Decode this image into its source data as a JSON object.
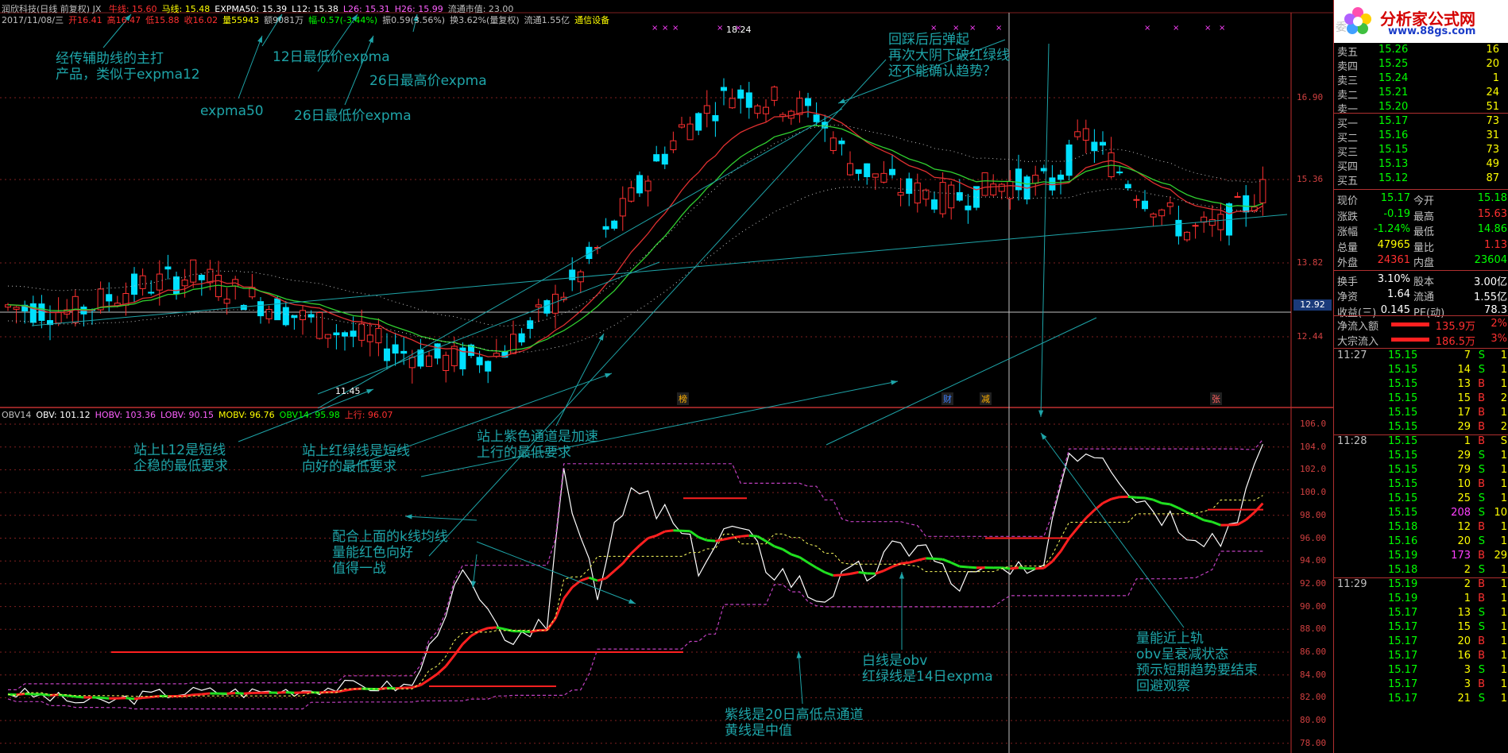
{
  "header": {
    "stock": "润欣科技(日线 前复权) JX",
    "ma_labels": [
      {
        "label": "牛线: 15.60",
        "color": "#ff3030"
      },
      {
        "label": "马线: 15.48",
        "color": "#ffff00"
      },
      {
        "label": "EXPMA50: 15.39",
        "color": "#ffffff"
      },
      {
        "label": "L12: 15.38",
        "color": "#ffffff"
      },
      {
        "label": "L26: 15.31",
        "color": "#ff60ff"
      },
      {
        "label": "H26: 15.99",
        "color": "#ff60ff"
      },
      {
        "label": "流通市值: 23.00",
        "color": "#c0c0c0"
      }
    ],
    "quote_line": [
      {
        "label": "2017/11/08/三",
        "color": "#c0c0c0"
      },
      {
        "label": "开16.41",
        "color": "#ff3030"
      },
      {
        "label": "高16.47",
        "color": "#ff3030"
      },
      {
        "label": "低15.88",
        "color": "#ff3030"
      },
      {
        "label": "收16.02",
        "color": "#ff3030"
      },
      {
        "label": "量55943",
        "color": "#ffff00"
      },
      {
        "label": "额9081万",
        "color": "#c0c0c0"
      },
      {
        "label": "幅-0.57(-3.44%)",
        "color": "#00ff00"
      },
      {
        "label": "振0.59(3.56%)",
        "color": "#c0c0c0"
      },
      {
        "label": "换3.62%(量复权)",
        "color": "#c0c0c0"
      },
      {
        "label": "流通1.55亿",
        "color": "#c0c0c0"
      },
      {
        "label": "通信设备",
        "color": "#ffff00"
      }
    ]
  },
  "obv_header": [
    {
      "label": "OBV14",
      "color": "#c0c0c0"
    },
    {
      "label": "OBV: 101.12",
      "color": "#ffffff"
    },
    {
      "label": "HOBV: 103.36",
      "color": "#ff60ff"
    },
    {
      "label": "LOBV: 90.15",
      "color": "#ff60ff"
    },
    {
      "label": "MOBV: 96.76",
      "color": "#ffff00"
    },
    {
      "label": "OBV14: 95.98",
      "color": "#00ff00"
    },
    {
      "label": "上行: 96.07",
      "color": "#ff3030"
    }
  ],
  "price_axis": [
    "16.90",
    "15.36",
    "13.82",
    "12.44"
  ],
  "price_tag": "12.92",
  "high_label": "18.24",
  "low_label": "11.45",
  "obv_axis": [
    "106.0",
    "104.0",
    "102.0",
    "100.0",
    "98.00",
    "96.00",
    "94.00",
    "92.00",
    "90.00",
    "88.00",
    "86.00",
    "84.00",
    "82.00",
    "80.00",
    "78.00"
  ],
  "event_marks": [
    {
      "label": "榜",
      "color": "#ffb000"
    },
    {
      "label": "财",
      "color": "#4080ff"
    },
    {
      "label": "减",
      "color": "#ffb000"
    },
    {
      "label": "张",
      "color": "#ff6060"
    }
  ],
  "annotations": [
    {
      "text": "经传辅助线的主打\n产品，类似于expma12"
    },
    {
      "text": "12日最低价expma"
    },
    {
      "text": "26日最高价expma"
    },
    {
      "text": "expma50"
    },
    {
      "text": "26日最低价expma"
    },
    {
      "text": "回踩后后弹起\n再次大阴下破红绿线\n还不能确认趋势？"
    },
    {
      "text": "站上L12是短线\n企稳的最低要求"
    },
    {
      "text": "站上红绿线是短线\n向好的最低要求"
    },
    {
      "text": "站上紫色通道是加速\n上行的最低要求"
    },
    {
      "text": "配合上面的k线均线\n量能红色向好\n值得一战"
    },
    {
      "text": "白线是obv\n红绿线是14日expma"
    },
    {
      "text": "紫线是20日高低点通道\n黄线是中值"
    },
    {
      "text": "量能近上轨\nobv呈衰减状态\n预示短期趋势要结束\n回避观察"
    }
  ],
  "logo": {
    "title": "分析家公式网",
    "url": "www.88gs.com",
    "corner": "委"
  },
  "order_book": {
    "asks": [
      {
        "label": "卖五",
        "price": "15.26",
        "vol": "16"
      },
      {
        "label": "卖四",
        "price": "15.25",
        "vol": "20"
      },
      {
        "label": "卖三",
        "price": "15.24",
        "vol": "1"
      },
      {
        "label": "卖二",
        "price": "15.21",
        "vol": "24"
      },
      {
        "label": "卖一",
        "price": "15.20",
        "vol": "51"
      }
    ],
    "bids": [
      {
        "label": "买一",
        "price": "15.17",
        "vol": "73"
      },
      {
        "label": "买二",
        "price": "15.16",
        "vol": "31"
      },
      {
        "label": "买三",
        "price": "15.15",
        "vol": "73"
      },
      {
        "label": "买四",
        "price": "15.13",
        "vol": "49"
      },
      {
        "label": "买五",
        "price": "15.12",
        "vol": "87"
      }
    ]
  },
  "stats": [
    {
      "l1": "现价",
      "v1": "15.17",
      "c1": "#00ff00",
      "l2": "今开",
      "v2": "15.18",
      "c2": "#00ff00"
    },
    {
      "l1": "涨跌",
      "v1": "-0.19",
      "c1": "#00ff00",
      "l2": "最高",
      "v2": "15.63",
      "c2": "#ff3030"
    },
    {
      "l1": "涨幅",
      "v1": "-1.24%",
      "c1": "#00ff00",
      "l2": "最低",
      "v2": "14.86",
      "c2": "#00ff00"
    },
    {
      "l1": "总量",
      "v1": "47965",
      "c1": "#ffff00",
      "l2": "量比",
      "v2": "1.13",
      "c2": "#ff3030"
    },
    {
      "l1": "外盘",
      "v1": "24361",
      "c1": "#ff3030",
      "l2": "内盘",
      "v2": "23604",
      "c2": "#00ff00"
    },
    {
      "l1": "换手",
      "v1": "3.10%",
      "c1": "#ffffff",
      "l2": "股本",
      "v2": "3.00亿",
      "c2": "#ffffff"
    },
    {
      "l1": "净资",
      "v1": "1.64",
      "c1": "#ffffff",
      "l2": "流通",
      "v2": "1.55亿",
      "c2": "#ffffff"
    },
    {
      "l1": "收益(三)",
      "v1": "0.145",
      "c1": "#ffffff",
      "l2": "PE(动)",
      "v2": "78.3",
      "c2": "#ffffff"
    }
  ],
  "flows": [
    {
      "label": "净流入额",
      "value": "135.9万",
      "pct": "2%"
    },
    {
      "label": "大宗流入",
      "value": "186.5万",
      "pct": "3%"
    }
  ],
  "ticks": [
    {
      "time": "11:27",
      "price": "15.15",
      "vol": "7",
      "side": "S"
    },
    {
      "time": "",
      "price": "15.15",
      "vol": "14",
      "side": "S"
    },
    {
      "time": "",
      "price": "15.15",
      "vol": "13",
      "side": "B"
    },
    {
      "time": "",
      "price": "15.15",
      "vol": "15",
      "side": "B"
    },
    {
      "time": "",
      "price": "15.15",
      "vol": "17",
      "side": "B"
    },
    {
      "time": "",
      "price": "15.15",
      "vol": "29",
      "side": "B"
    },
    {
      "time": "11:28",
      "price": "15.15",
      "vol": "1",
      "side": "B"
    },
    {
      "time": "",
      "price": "15.15",
      "vol": "29",
      "side": "S"
    },
    {
      "time": "",
      "price": "15.15",
      "vol": "79",
      "side": "S"
    },
    {
      "time": "",
      "price": "15.15",
      "vol": "10",
      "side": "B"
    },
    {
      "time": "",
      "price": "15.15",
      "vol": "25",
      "side": "S"
    },
    {
      "time": "",
      "price": "15.15",
      "vol": "208",
      "side": "S"
    },
    {
      "time": "",
      "price": "15.18",
      "vol": "12",
      "side": "B"
    },
    {
      "time": "",
      "price": "15.16",
      "vol": "20",
      "side": "S"
    },
    {
      "time": "",
      "price": "15.19",
      "vol": "173",
      "side": "B"
    },
    {
      "time": "",
      "price": "15.18",
      "vol": "2",
      "side": "S"
    },
    {
      "time": "11:29",
      "price": "15.19",
      "vol": "2",
      "side": "B"
    },
    {
      "time": "",
      "price": "15.19",
      "vol": "1",
      "side": "B"
    },
    {
      "time": "",
      "price": "15.17",
      "vol": "13",
      "side": "S"
    },
    {
      "time": "",
      "price": "15.17",
      "vol": "15",
      "side": "S"
    },
    {
      "time": "",
      "price": "15.17",
      "vol": "20",
      "side": "B"
    },
    {
      "time": "",
      "price": "15.17",
      "vol": "16",
      "side": "B"
    },
    {
      "time": "",
      "price": "15.17",
      "vol": "3",
      "side": "S"
    },
    {
      "time": "",
      "price": "15.17",
      "vol": "3",
      "side": "B"
    },
    {
      "time": "",
      "price": "15.17",
      "vol": "21",
      "side": "S"
    }
  ],
  "ticks_right_edge": [
    "1",
    "1",
    "1",
    "2",
    "1",
    "2",
    "S",
    "1",
    "1",
    "1",
    "1",
    "10",
    "1",
    "1",
    "29",
    "1",
    "1",
    "1",
    "1",
    "1",
    "1",
    "1",
    "1",
    "1",
    "1"
  ]
}
